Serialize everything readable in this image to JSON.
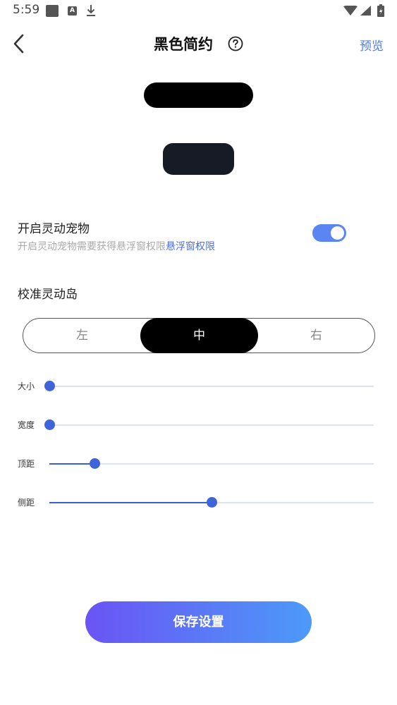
{
  "status_bar": {
    "time": "5:59",
    "icons": [
      "square-app-icon",
      "a-notification-icon",
      "download-icon",
      "wifi-icon",
      "signal-icon",
      "battery-icon"
    ]
  },
  "header": {
    "back_icon": "chevron-left-icon",
    "title": "黑色简约",
    "help_icon": "question-circle-icon",
    "preview_label": "预览"
  },
  "pet": {
    "title": "开启灵动宠物",
    "description": "开启灵动宠物需要获得悬浮窗权限",
    "permission_link": "悬浮窗权限",
    "enabled": true
  },
  "calibrate": {
    "title": "校准灵动岛",
    "options": [
      "左",
      "中",
      "右"
    ],
    "selected": "中"
  },
  "sliders": [
    {
      "label": "大小",
      "value": 0
    },
    {
      "label": "宽度",
      "value": 0
    },
    {
      "label": "顶距",
      "value": 0.14
    },
    {
      "label": "侧距",
      "value": 0.5
    }
  ],
  "save_label": "保存设置",
  "colors": {
    "accent": "#4a7cf0",
    "toggle_on": "#5b85f2",
    "slider_thumb": "#3f63d8",
    "save_gradient_start": "#6a54f5",
    "save_gradient_end": "#4c9af8"
  }
}
